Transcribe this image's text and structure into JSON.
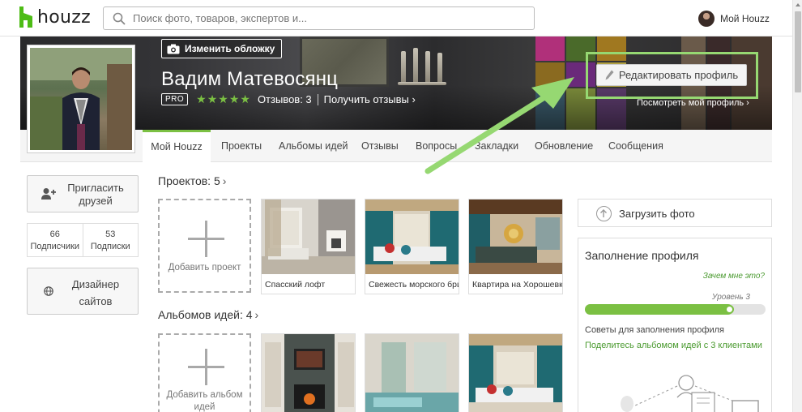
{
  "header": {
    "logo_text": "houzz",
    "search_placeholder": "Поиск фото, товаров, экспертов и...",
    "account_label": "Мой Houzz"
  },
  "cover": {
    "change_cover_label": "Изменить обложку",
    "name": "Вадим Матевосянц",
    "pro_badge": "PRO",
    "stars": "★★★★★",
    "reviews": "Отзывов: 3",
    "get_reviews": "Получить отзывы ›",
    "edit_profile": "Редактировать профиль",
    "view_profile": "Посмотреть мой профиль ›"
  },
  "tabs": [
    {
      "label": "Мой Houzz",
      "active": true
    },
    {
      "label": "Проекты"
    },
    {
      "label": "Альбомы идей"
    },
    {
      "label": "Отзывы"
    },
    {
      "label": "Вопросы"
    },
    {
      "label": "Закладки"
    },
    {
      "label": "Обновление"
    },
    {
      "label": "Сообщения"
    }
  ],
  "sidebar": {
    "invite_label": "Пригласить друзей",
    "followers_count": "66",
    "followers_label": "Подписчики",
    "following_count": "53",
    "following_label": "Подписки",
    "designer_label": "Дизайнер сайтов"
  },
  "projects": {
    "title": "Проектов: 5",
    "chevron": "›",
    "add_label": "Добавить проект",
    "items": [
      {
        "caption": "Спасский лофт"
      },
      {
        "caption": "Свежесть морского бриза"
      },
      {
        "caption": "Квартира на Хорошевке"
      }
    ]
  },
  "albums": {
    "title": "Альбомов идей: 4",
    "chevron": "›",
    "add_label": "Добавить альбом идей"
  },
  "right": {
    "upload_label": "Загрузить фото",
    "completion_title": "Заполнение профиля",
    "why_label": "Зачем мне это?",
    "level_label": "Уровень 3",
    "progress": 0.82,
    "tips_label": "Советы для заполнения профиля",
    "share_label": "Поделитесь альбомом идей с 3 клиентами"
  },
  "colors": {
    "brand_green": "#7bc043",
    "highlight_green": "#96d872"
  }
}
